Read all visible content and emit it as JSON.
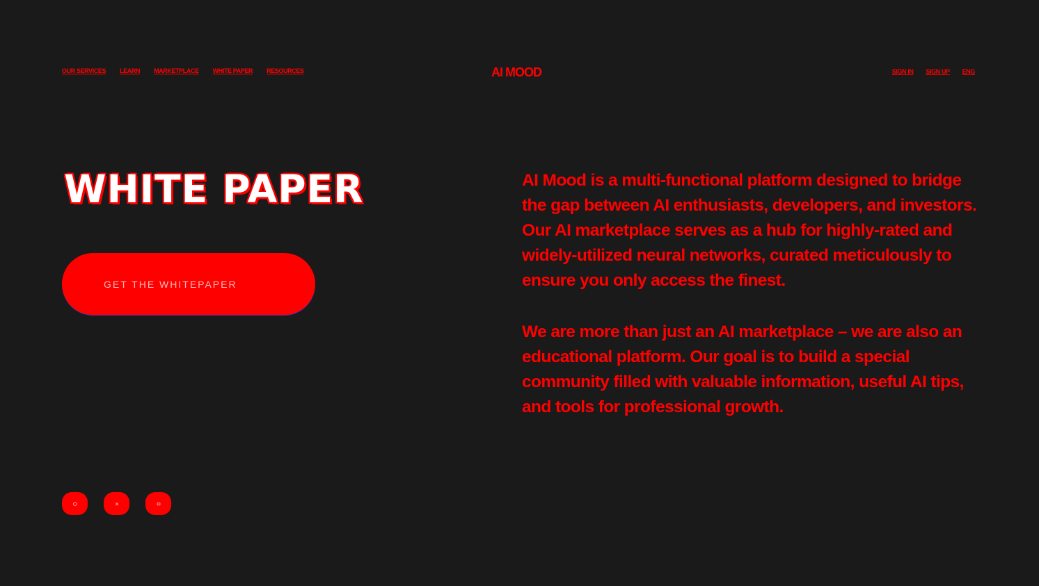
{
  "header": {
    "nav_left": [
      "OUR SERVICES",
      "LEARN",
      "MARKETPLACE",
      "WHITE PAPER",
      "RESOURCES"
    ],
    "logo": "AI MOOD",
    "nav_right": [
      "SIGN IN",
      "SIGN UP",
      "ENG"
    ]
  },
  "hero": {
    "title": "WHITE PAPER",
    "cta_label": "GET THE WHITEPAPER"
  },
  "main": {
    "paragraphs": [
      "AI Mood is a multi-functional platform designed to bridge the gap between AI enthusiasts, developers, and investors. Our AI marketplace serves as a hub for highly-rated and widely-utilized neural networks, curated meticulously to ensure you only access the finest.",
      "We are more than just an AI marketplace – we are also an educational platform. Our goal is to build a special community filled with valuable information, useful AI tips, and tools for professional growth."
    ]
  },
  "socials": [
    {
      "icon": "telegram-icon"
    },
    {
      "icon": "twitter-icon"
    },
    {
      "icon": "discord-icon"
    }
  ],
  "colors": {
    "background": "#1a1a1a",
    "accent": "#ff0000",
    "title_fill": "#ffffff"
  }
}
